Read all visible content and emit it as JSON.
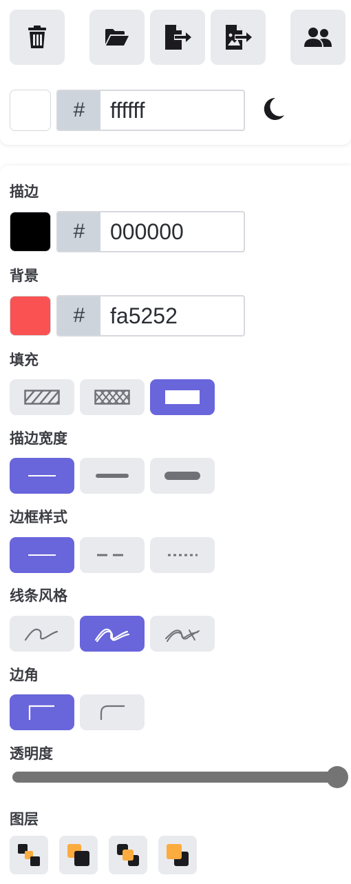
{
  "toolbar": {
    "buttons": [
      {
        "name": "delete-button",
        "icon": "trash-icon"
      },
      {
        "name": "open-button",
        "icon": "folder-open-icon"
      },
      {
        "name": "export-button",
        "icon": "file-export-icon"
      },
      {
        "name": "export-image-button",
        "icon": "file-image-export-icon"
      },
      {
        "name": "collaborate-button",
        "icon": "users-icon"
      }
    ]
  },
  "canvas_background": {
    "color": "#ffffff",
    "hash": "#",
    "hex": "ffffff",
    "theme_toggle_icon": "moon-icon"
  },
  "stroke": {
    "label": "描边",
    "color": "#000000",
    "hash": "#",
    "hex": "000000"
  },
  "background": {
    "label": "背景",
    "color": "#fa5252",
    "hash": "#",
    "hex": "fa5252"
  },
  "fill": {
    "label": "填充",
    "options": [
      "hachure",
      "cross-hatch",
      "solid"
    ],
    "selected": "solid"
  },
  "stroke_width": {
    "label": "描边宽度",
    "options": [
      "thin",
      "bold",
      "extra-bold"
    ],
    "selected": "thin"
  },
  "stroke_style": {
    "label": "边框样式",
    "options": [
      "solid",
      "dashed",
      "dotted"
    ],
    "selected": "solid"
  },
  "sloppiness": {
    "label": "线条风格",
    "options": [
      "architect",
      "artist",
      "cartoonist"
    ],
    "selected": "artist"
  },
  "edges": {
    "label": "边角",
    "options": [
      "sharp",
      "round"
    ],
    "selected": "sharp"
  },
  "opacity": {
    "label": "透明度",
    "value": 100
  },
  "layers": {
    "label": "图层",
    "buttons": [
      "send-to-back",
      "send-backward",
      "bring-forward",
      "bring-to-front"
    ]
  },
  "colors": {
    "accent": "#6965db",
    "button_bg": "#e9eaee",
    "icon": "#1b1b1f"
  }
}
